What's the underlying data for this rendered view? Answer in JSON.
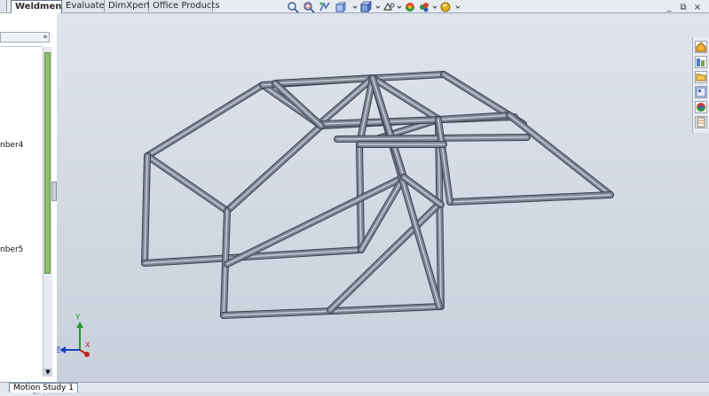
{
  "tabs": [
    {
      "label": "Weldments",
      "active": true
    },
    {
      "label": "Evaluate",
      "active": false
    },
    {
      "label": "DimXpert",
      "active": false
    },
    {
      "label": "Office Products",
      "active": false
    }
  ],
  "panel": {
    "collapse_glyph": "»",
    "members": [
      "nber4",
      "nber5"
    ]
  },
  "status": {
    "motion_tab": "Motion Study 1"
  },
  "triad": {
    "x_label": "X",
    "y_label": "Y",
    "z_label": "Z"
  },
  "window_controls": [
    "_",
    "⧉",
    "×"
  ],
  "colors": {
    "viewport_bg": "#d2d8e2",
    "tube_fill": "#7d8694",
    "tube_edge": "#3b424d",
    "tube_highlight": "#c6ccd6"
  },
  "heads_up_icons": [
    "zoom-to-fit-icon",
    "zoom-to-area-icon",
    "previous-view-icon",
    "section-view-icon",
    "view-orientation-icon",
    "display-style-icon",
    "hide-show-items-icon",
    "edit-appearance-icon",
    "apply-scene-icon",
    "view-settings-icon"
  ],
  "task_pane_icons": [
    "solidworks-resources-icon",
    "design-library-icon",
    "file-explorer-icon",
    "view-palette-icon",
    "appearances-icon",
    "custom-properties-icon"
  ]
}
